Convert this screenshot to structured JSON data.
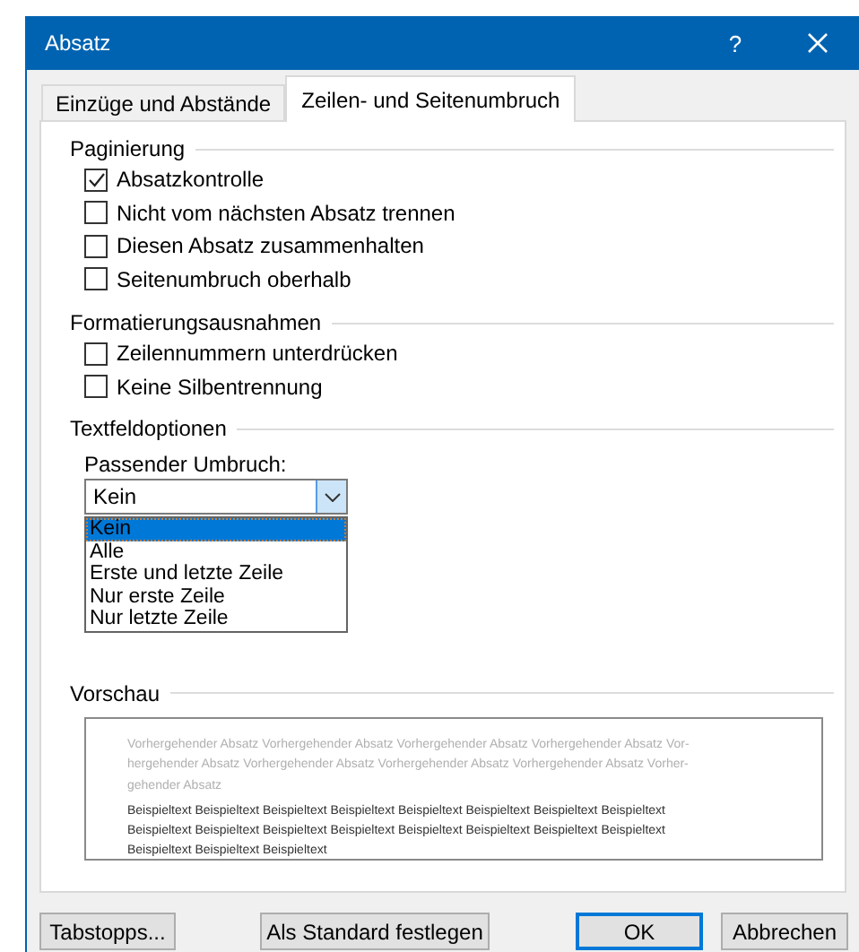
{
  "window": {
    "title": "Absatz",
    "help": "?"
  },
  "tabs": [
    {
      "label": "Einzüge und Abstände",
      "selected": false
    },
    {
      "label": "Zeilen- und Seitenumbruch",
      "selected": true
    }
  ],
  "sections": [
    {
      "title": "Paginierung",
      "kind": "checkboxes",
      "options": [
        {
          "label": "Absatzkontrolle",
          "checked": true
        },
        {
          "label": "Nicht vom nächsten Absatz trennen",
          "checked": false
        },
        {
          "label": "Diesen Absatz zusammenhalten",
          "checked": false
        },
        {
          "label": "Seitenumbruch oberhalb",
          "checked": false
        }
      ]
    },
    {
      "title": "Formatierungsausnahmen",
      "kind": "checkboxes",
      "options": [
        {
          "label": "Zeilennummern unterdrücken",
          "checked": false
        },
        {
          "label": "Keine Silbentrennung",
          "checked": false
        }
      ]
    },
    {
      "title": "Textfeldoptionen",
      "kind": "dropdown",
      "label": "Passender Umbruch:",
      "value": "Kein",
      "expanded": true,
      "options": [
        {
          "label": "Kein",
          "selected": true
        },
        {
          "label": "Alle",
          "selected": false
        },
        {
          "label": "Erste und letzte Zeile",
          "selected": false
        },
        {
          "label": "Nur erste Zeile",
          "selected": false
        },
        {
          "label": "Nur letzte Zeile",
          "selected": false
        }
      ]
    }
  ],
  "preview": {
    "title": "Vorschau",
    "previous_lines": [
      "Vorhergehender Absatz Vorhergehender Absatz Vorhergehender Absatz Vorhergehender Absatz Vor-",
      "hergehender Absatz Vorhergehender Absatz Vorhergehender Absatz Vorhergehender Absatz Vorher-",
      "gehender Absatz"
    ],
    "sample_lines": [
      "Beispieltext Beispieltext Beispieltext Beispieltext Beispieltext Beispieltext Beispieltext Beispieltext",
      "Beispieltext Beispieltext Beispieltext Beispieltext Beispieltext Beispieltext Beispieltext Beispieltext",
      "Beispieltext Beispieltext Beispieltext"
    ]
  },
  "buttons": [
    {
      "label": "Tabstopps...",
      "default": false
    },
    {
      "label": "Als Standard festlegen",
      "default": false
    },
    {
      "label": "OK",
      "default": true
    },
    {
      "label": "Abbrechen",
      "default": false
    }
  ]
}
